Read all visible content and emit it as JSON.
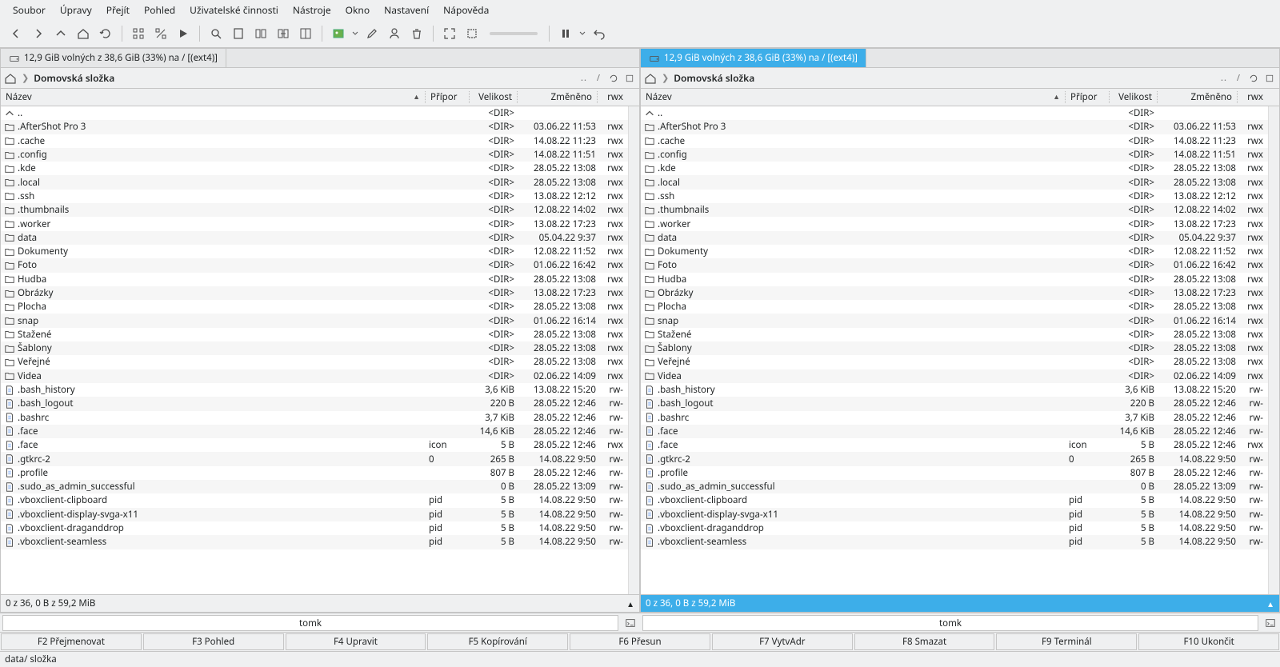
{
  "menu": [
    "Soubor",
    "Úpravy",
    "Přejít",
    "Pohled",
    "Uživatelské činnosti",
    "Nástroje",
    "Okno",
    "Nastavení",
    "Nápověda"
  ],
  "tab_label": "12,9 GiB volných z 38,6 GiB (33%) na / [(ext4)]",
  "breadcrumb": "Domovská složka",
  "columns": {
    "name": "Název",
    "ext": "Přípor",
    "size": "Velikost",
    "date": "Změněno",
    "rwx": "rwx"
  },
  "status_sel": "0 z 36, 0 B z  59,2 MiB",
  "prompt": "tomk",
  "fn": [
    "F2 Přejmenovat",
    "F3 Pohled",
    "F4 Upravit",
    "F5 Kopírování",
    "F6 Přesun",
    "F7 VytvAdr",
    "F8 Smazat",
    "F9 Terminál",
    "F10 Ukončit"
  ],
  "statusline": "data/  složka",
  "files": [
    {
      "t": "up",
      "n": "..",
      "e": "",
      "s": "<DIR>",
      "d": "",
      "r": ""
    },
    {
      "t": "d",
      "n": ".AfterShot Pro 3",
      "e": "",
      "s": "<DIR>",
      "d": "03.06.22 11:53",
      "r": "rwx"
    },
    {
      "t": "d",
      "n": ".cache",
      "e": "",
      "s": "<DIR>",
      "d": "14.08.22 11:23",
      "r": "rwx"
    },
    {
      "t": "d",
      "n": ".config",
      "e": "",
      "s": "<DIR>",
      "d": "14.08.22 11:51",
      "r": "rwx"
    },
    {
      "t": "d",
      "n": ".kde",
      "e": "",
      "s": "<DIR>",
      "d": "28.05.22 13:08",
      "r": "rwx"
    },
    {
      "t": "d",
      "n": ".local",
      "e": "",
      "s": "<DIR>",
      "d": "28.05.22 13:08",
      "r": "rwx"
    },
    {
      "t": "d",
      "n": ".ssh",
      "e": "",
      "s": "<DIR>",
      "d": "13.08.22 12:12",
      "r": "rwx"
    },
    {
      "t": "d",
      "n": ".thumbnails",
      "e": "",
      "s": "<DIR>",
      "d": "12.08.22 14:02",
      "r": "rwx"
    },
    {
      "t": "d",
      "n": ".worker",
      "e": "",
      "s": "<DIR>",
      "d": "13.08.22 17:23",
      "r": "rwx"
    },
    {
      "t": "d",
      "n": "data",
      "e": "",
      "s": "<DIR>",
      "d": "05.04.22 9:37",
      "r": "rwx"
    },
    {
      "t": "d",
      "n": "Dokumenty",
      "e": "",
      "s": "<DIR>",
      "d": "12.08.22 11:52",
      "r": "rwx"
    },
    {
      "t": "d",
      "n": "Foto",
      "e": "",
      "s": "<DIR>",
      "d": "01.06.22 16:42",
      "r": "rwx"
    },
    {
      "t": "d",
      "n": "Hudba",
      "e": "",
      "s": "<DIR>",
      "d": "28.05.22 13:08",
      "r": "rwx"
    },
    {
      "t": "d",
      "n": "Obrázky",
      "e": "",
      "s": "<DIR>",
      "d": "13.08.22 17:23",
      "r": "rwx"
    },
    {
      "t": "d",
      "n": "Plocha",
      "e": "",
      "s": "<DIR>",
      "d": "28.05.22 13:08",
      "r": "rwx"
    },
    {
      "t": "d",
      "n": "snap",
      "e": "",
      "s": "<DIR>",
      "d": "01.06.22 16:14",
      "r": "rwx"
    },
    {
      "t": "d",
      "n": "Stažené",
      "e": "",
      "s": "<DIR>",
      "d": "28.05.22 13:08",
      "r": "rwx"
    },
    {
      "t": "d",
      "n": "Šablony",
      "e": "",
      "s": "<DIR>",
      "d": "28.05.22 13:08",
      "r": "rwx"
    },
    {
      "t": "d",
      "n": "Veřejné",
      "e": "",
      "s": "<DIR>",
      "d": "28.05.22 13:08",
      "r": "rwx"
    },
    {
      "t": "d",
      "n": "Videa",
      "e": "",
      "s": "<DIR>",
      "d": "02.06.22 14:09",
      "r": "rwx"
    },
    {
      "t": "f",
      "n": ".bash_history",
      "e": "",
      "s": "3,6 KiB",
      "d": "13.08.22 15:20",
      "r": "rw-"
    },
    {
      "t": "f",
      "n": ".bash_logout",
      "e": "",
      "s": "220 B",
      "d": "28.05.22 12:46",
      "r": "rw-"
    },
    {
      "t": "f",
      "n": ".bashrc",
      "e": "",
      "s": "3,7 KiB",
      "d": "28.05.22 12:46",
      "r": "rw-"
    },
    {
      "t": "f",
      "n": ".face",
      "e": "",
      "s": "14,6 KiB",
      "d": "28.05.22 12:46",
      "r": "rw-"
    },
    {
      "t": "f",
      "n": ".face",
      "e": "icon",
      "s": "5 B",
      "d": "28.05.22 12:46",
      "r": "rwx"
    },
    {
      "t": "f",
      "n": ".gtkrc-2",
      "e": "0",
      "s": "265 B",
      "d": "14.08.22 9:50",
      "r": "rw-"
    },
    {
      "t": "f",
      "n": ".profile",
      "e": "",
      "s": "807 B",
      "d": "28.05.22 12:46",
      "r": "rw-"
    },
    {
      "t": "f",
      "n": ".sudo_as_admin_successful",
      "e": "",
      "s": "0 B",
      "d": "28.05.22 13:09",
      "r": "rw-"
    },
    {
      "t": "f",
      "n": ".vboxclient-clipboard",
      "e": "pid",
      "s": "5 B",
      "d": "14.08.22 9:50",
      "r": "rw-"
    },
    {
      "t": "f",
      "n": ".vboxclient-display-svga-x11",
      "e": "pid",
      "s": "5 B",
      "d": "14.08.22 9:50",
      "r": "rw-"
    },
    {
      "t": "f",
      "n": ".vboxclient-draganddrop",
      "e": "pid",
      "s": "5 B",
      "d": "14.08.22 9:50",
      "r": "rw-"
    },
    {
      "t": "f",
      "n": ".vboxclient-seamless",
      "e": "pid",
      "s": "5 B",
      "d": "14.08.22 9:50",
      "r": "rw-"
    }
  ]
}
